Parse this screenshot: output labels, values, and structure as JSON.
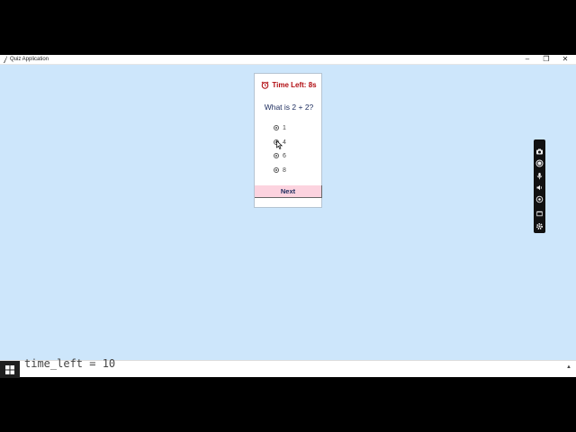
{
  "window": {
    "title": "Quiz Application",
    "controls": {
      "minimize": "–",
      "maximize": "❐",
      "close": "✕"
    }
  },
  "quiz": {
    "timer_text": "Time Left: 8s",
    "question": "What is 2 + 2?",
    "options": [
      "1",
      "4",
      "6",
      "8"
    ],
    "next_label": "Next"
  },
  "taskbar": {
    "code_text": "time_left = 10"
  },
  "colors": {
    "window_bg": "#cde6fb",
    "timer_red": "#b10d12",
    "next_bg": "#fcd3df",
    "question_text": "#1a2a5c"
  },
  "icons": {
    "clock": "alarm-clock-icon",
    "recorder": [
      "camera-icon",
      "record-icon",
      "mic-icon",
      "speaker-icon",
      "webcam-icon",
      "window-icon",
      "gear-icon"
    ]
  }
}
